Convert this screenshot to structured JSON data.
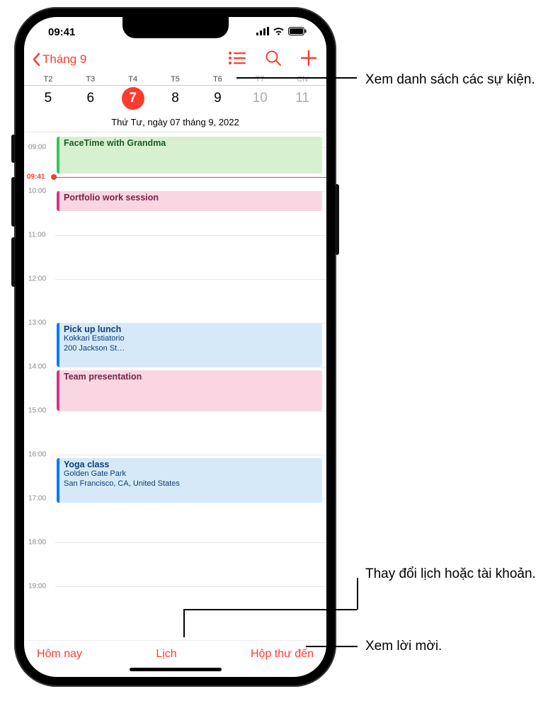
{
  "status": {
    "time": "09:41"
  },
  "nav": {
    "back_label": "Tháng 9"
  },
  "week": {
    "day_labels": [
      "T2",
      "T3",
      "T4",
      "T5",
      "T6",
      "T7",
      "CN"
    ],
    "dates": [
      "5",
      "6",
      "7",
      "8",
      "9",
      "10",
      "11"
    ],
    "selected_index": 2,
    "full_date": "Thứ Tư, ngày 07 tháng 9, 2022"
  },
  "timeline": {
    "hours": [
      "09:00",
      "10:00",
      "11:00",
      "12:00",
      "13:00",
      "14:00",
      "15:00",
      "16:00",
      "17:00",
      "18:00",
      "19:00"
    ],
    "now": "09:41"
  },
  "events": [
    {
      "title": "FaceTime with Grandma",
      "sub1": "",
      "sub2": "",
      "color": "green"
    },
    {
      "title": "Portfolio work session",
      "sub1": "",
      "sub2": "",
      "color": "pink"
    },
    {
      "title": "Pick up lunch",
      "sub1": "Kokkari Estiatorio",
      "sub2": "200 Jackson St…",
      "color": "blue"
    },
    {
      "title": "Team presentation",
      "sub1": "",
      "sub2": "",
      "color": "pink"
    },
    {
      "title": "Yoga class",
      "sub1": "Golden Gate Park",
      "sub2": "San Francisco, CA, United States",
      "color": "blue"
    }
  ],
  "toolbar": {
    "today": "Hôm nay",
    "calendars": "Lịch",
    "inbox": "Hộp thư đến"
  },
  "callouts": {
    "list": "Xem danh sách các sự kiện.",
    "calendars": "Thay đổi lịch hoặc tài khoản.",
    "inbox": "Xem lời mời."
  }
}
